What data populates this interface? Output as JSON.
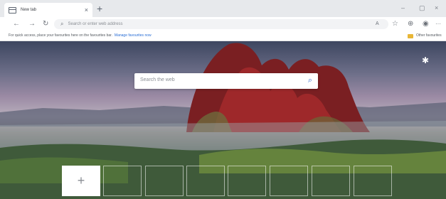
{
  "tab": {
    "title": "New tab",
    "close": "×",
    "new_tab": "+"
  },
  "window_controls": {
    "minimize": "–",
    "maximize": "▢",
    "close": "×"
  },
  "toolbar": {
    "back": "←",
    "forward": "→",
    "refresh": "↻",
    "address_placeholder": "Search or enter web address",
    "read_aloud": "A",
    "favorites": "☆",
    "collections": "⊕",
    "profile": "◉",
    "more": "···"
  },
  "favorites_bar": {
    "hint": "For quick access, place your favourites here on the favourites bar.",
    "link": "Manage favourites now",
    "other": "Other favourites"
  },
  "new_tab_page": {
    "search_placeholder": "Search the web",
    "search_icon": "⌕",
    "settings_icon": "✱",
    "add_tile": "+",
    "tiles": [
      "",
      "",
      "",
      "",
      "",
      "",
      ""
    ]
  },
  "colors": {
    "accent": "#2b6fd6",
    "tabstrip": "#e7e9ec",
    "folder": "#e8b637"
  }
}
